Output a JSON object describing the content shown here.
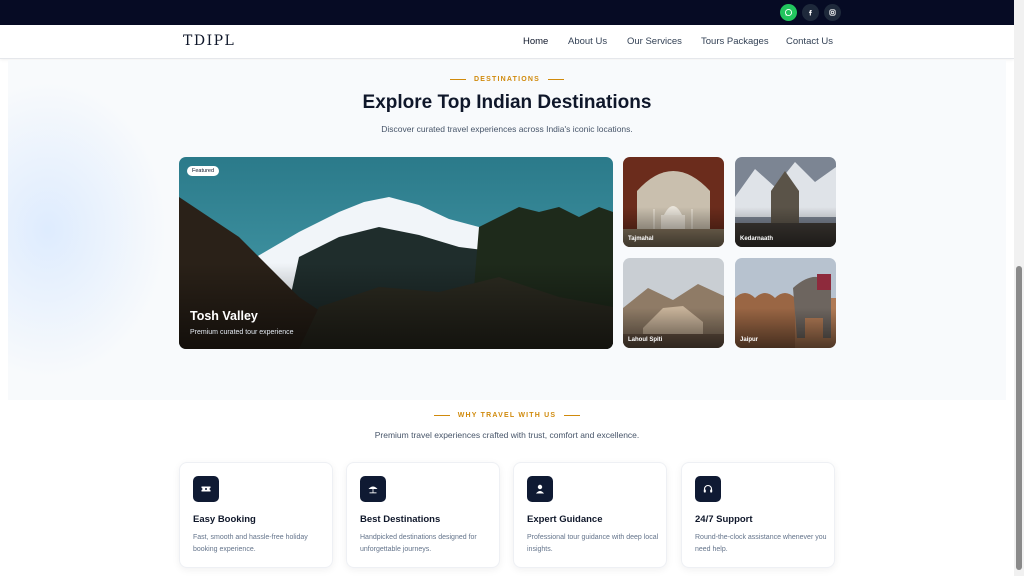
{
  "social": [
    {
      "name": "whatsapp-icon",
      "color": "#22c55e"
    },
    {
      "name": "facebook-icon",
      "color": "#1e293b"
    },
    {
      "name": "instagram-icon",
      "color": "#1e293b"
    }
  ],
  "nav": {
    "logo": "TDIPL",
    "items": [
      "Home",
      "About Us",
      "Our Services",
      "Tours Packages",
      "Contact Us"
    ],
    "active": "Home"
  },
  "destinations": {
    "eyebrow": "DESTINATIONS",
    "title": "Explore Top Indian Destinations",
    "subtitle": "Discover curated travel experiences across India's iconic locations.",
    "featured": {
      "badge": "Featured",
      "title": "Tosh Valley",
      "subtitle": "Premium curated tour experience"
    },
    "cards": [
      "Tajmahal",
      "Kedarnaath",
      "Lahoul Spiti",
      "Jaipur"
    ]
  },
  "why": {
    "eyebrow": "WHY TRAVEL WITH US",
    "subtitle": "Premium travel experiences crafted with trust, comfort and excellence.",
    "features": [
      {
        "icon": "ticket-icon",
        "title": "Easy Booking",
        "desc": "Fast, smooth and hassle-free holiday booking experience."
      },
      {
        "icon": "umbrella-beach-icon",
        "title": "Best Destinations",
        "desc": "Handpicked destinations designed for unforgettable journeys."
      },
      {
        "icon": "user-icon",
        "title": "Expert Guidance",
        "desc": "Professional tour guidance with deep local insights."
      },
      {
        "icon": "headset-icon",
        "title": "24/7 Support",
        "desc": "Round-the-clock assistance whenever you need help."
      }
    ]
  },
  "colors": {
    "topbar": "#060b24",
    "accent": "#d08a0c",
    "icon_bg": "#0f1a33",
    "whatsapp": "#22c55e"
  }
}
